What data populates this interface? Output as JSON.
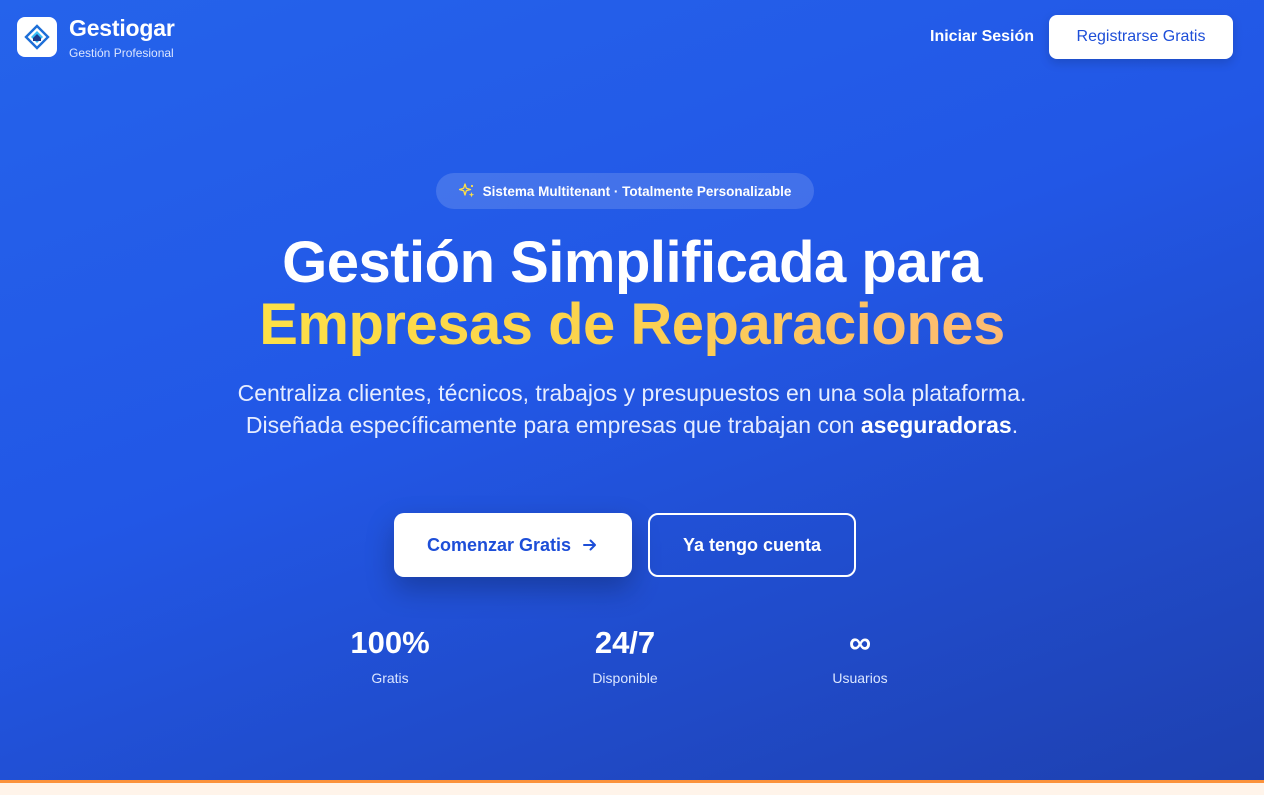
{
  "header": {
    "brand_name": "Gestiogar",
    "brand_subtitle": "Gestión Profesional",
    "login_label": "Iniciar Sesión",
    "register_label": "Registrarse Gratis"
  },
  "hero": {
    "badge_text": "Sistema Multitenant · Totalmente Personalizable",
    "title_line1": "Gestión Simplificada para",
    "title_line2": "Empresas de Reparaciones",
    "description_part1": "Centraliza clientes, técnicos, trabajos y presupuestos en una sola plataforma. Diseñada específicamente para empresas que trabajan con ",
    "description_bold": "aseguradoras",
    "description_end": ".",
    "primary_button": "Comenzar Gratis",
    "secondary_button": "Ya tengo cuenta"
  },
  "stats": [
    {
      "value": "100%",
      "label": "Gratis"
    },
    {
      "value": "24/7",
      "label": "Disponible"
    },
    {
      "value": "∞",
      "label": "Usuarios"
    }
  ],
  "icons": {
    "logo": "house-diamond-logo-icon",
    "badge": "sparkles-icon",
    "primary_button": "arrow-right-icon"
  },
  "colors": {
    "background_start": "#2563eb",
    "background_end": "#1e40af",
    "accent_yellow": "#fcd34d",
    "accent_orange": "#fdba74",
    "button_text_blue": "#1d4ed8"
  }
}
